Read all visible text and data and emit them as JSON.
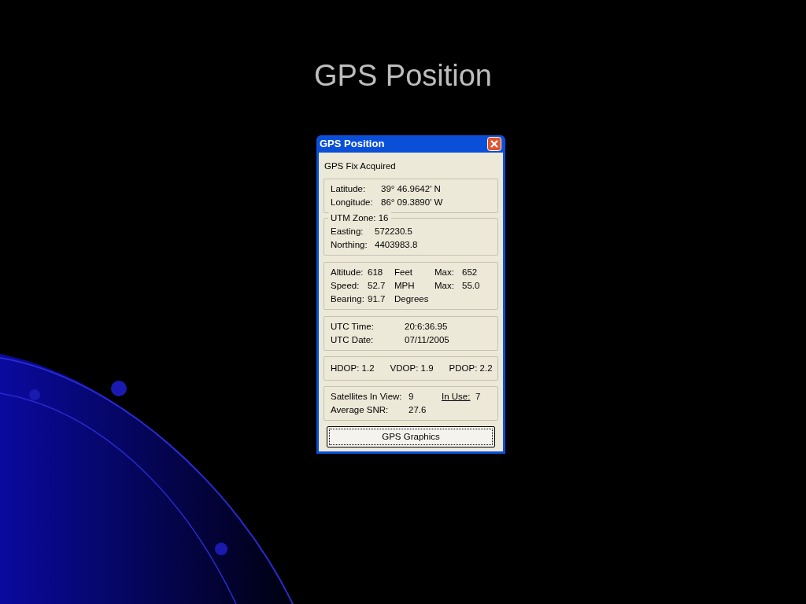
{
  "slide_title": "GPS Position",
  "window": {
    "title": "GPS Position"
  },
  "status": "GPS Fix Acquired",
  "position": [
    {
      "label": "Latitude:",
      "value": "39° 46.9642' N"
    },
    {
      "label": "Longitude:",
      "value": "86° 09.3890' W"
    }
  ],
  "utm": {
    "caption": "UTM Zone: 16",
    "rows": [
      {
        "label": "Easting:",
        "value": "572230.5"
      },
      {
        "label": "Northing:",
        "value": "4403983.8"
      }
    ]
  },
  "motion": [
    {
      "label": "Altitude:",
      "value": "618",
      "unit": "Feet",
      "max_label": "Max:",
      "max_value": "652"
    },
    {
      "label": "Speed:",
      "value": "52.7",
      "unit": "MPH",
      "max_label": "Max:",
      "max_value": "55.0"
    },
    {
      "label": "Bearing:",
      "value": "91.7",
      "unit": "Degrees"
    }
  ],
  "time": [
    {
      "label": "UTC Time:",
      "value": "20:6:36.95"
    },
    {
      "label": "UTC Date:",
      "value": "07/11/2005"
    }
  ],
  "dop": [
    "HDOP: 1.2",
    "VDOP: 1.9",
    "PDOP: 2.2"
  ],
  "satellites": [
    {
      "label": "Satellites In View:",
      "value": "9",
      "link": "In Use:",
      "link_value": "7"
    },
    {
      "label": "Average SNR:",
      "value": "27.6"
    }
  ],
  "button": {
    "label": "GPS Graphics",
    "focused": true
  }
}
